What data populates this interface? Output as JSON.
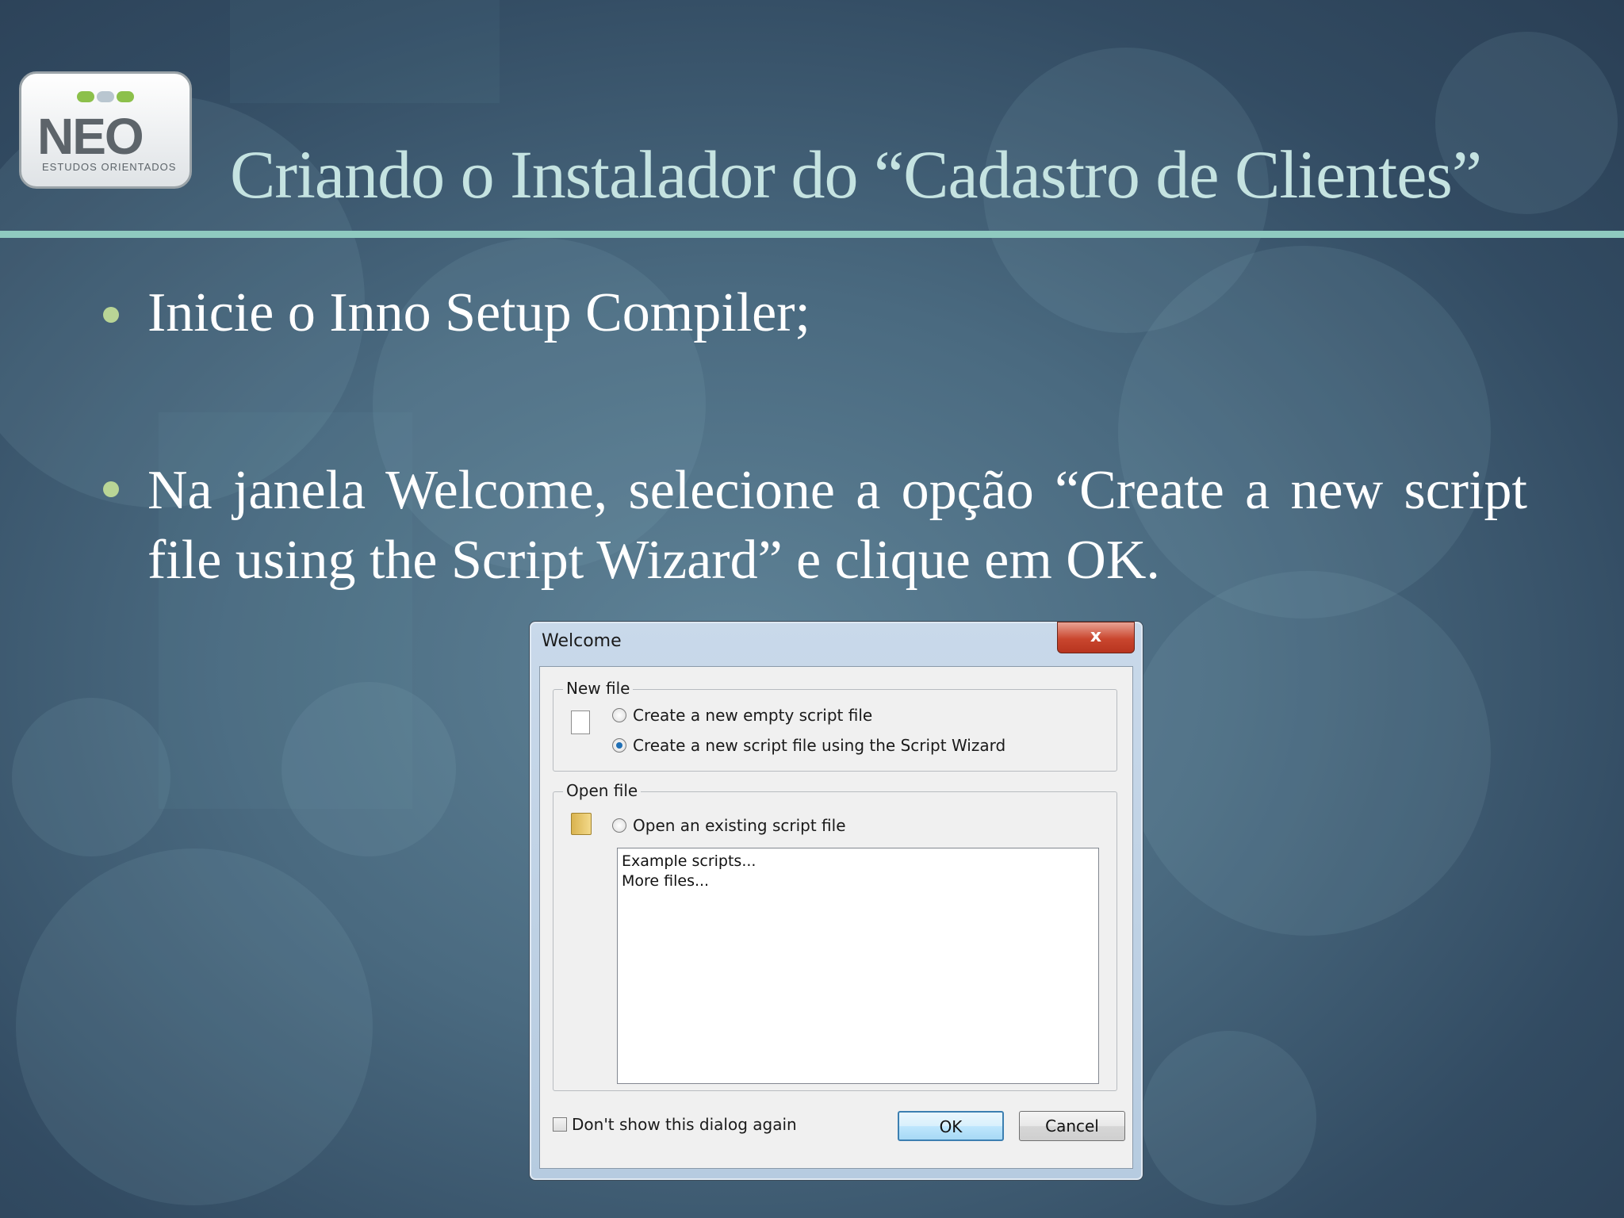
{
  "slide": {
    "title": "Criando o Instalador do “Cadastro de Clientes”",
    "bullets": [
      "Inicie o Inno Setup Compiler;",
      "Na janela Welcome, selecione a opção “Create a new script file using the Script Wizard” e clique em OK."
    ],
    "colors": {
      "title": "#c5e3e1",
      "rule": "#8fcac0",
      "bullet_dot": "#b9d596",
      "background": "#3c5a70"
    }
  },
  "logo": {
    "main": "NEO",
    "sub": "ESTUDOS ORIENTADOS"
  },
  "dialog": {
    "title": "Welcome",
    "close_label": "x",
    "new_file": {
      "label": "New file",
      "options": [
        {
          "label": "Create a new empty script file",
          "checked": false
        },
        {
          "label": "Create a new script file using the Script Wizard",
          "checked": true
        }
      ]
    },
    "open_file": {
      "label": "Open file",
      "option": {
        "label": "Open an existing script file",
        "checked": false
      },
      "list_items": [
        "Example scripts...",
        "More files..."
      ]
    },
    "dont_show_label": "Don't show this dialog again",
    "ok_label": "OK",
    "cancel_label": "Cancel"
  }
}
